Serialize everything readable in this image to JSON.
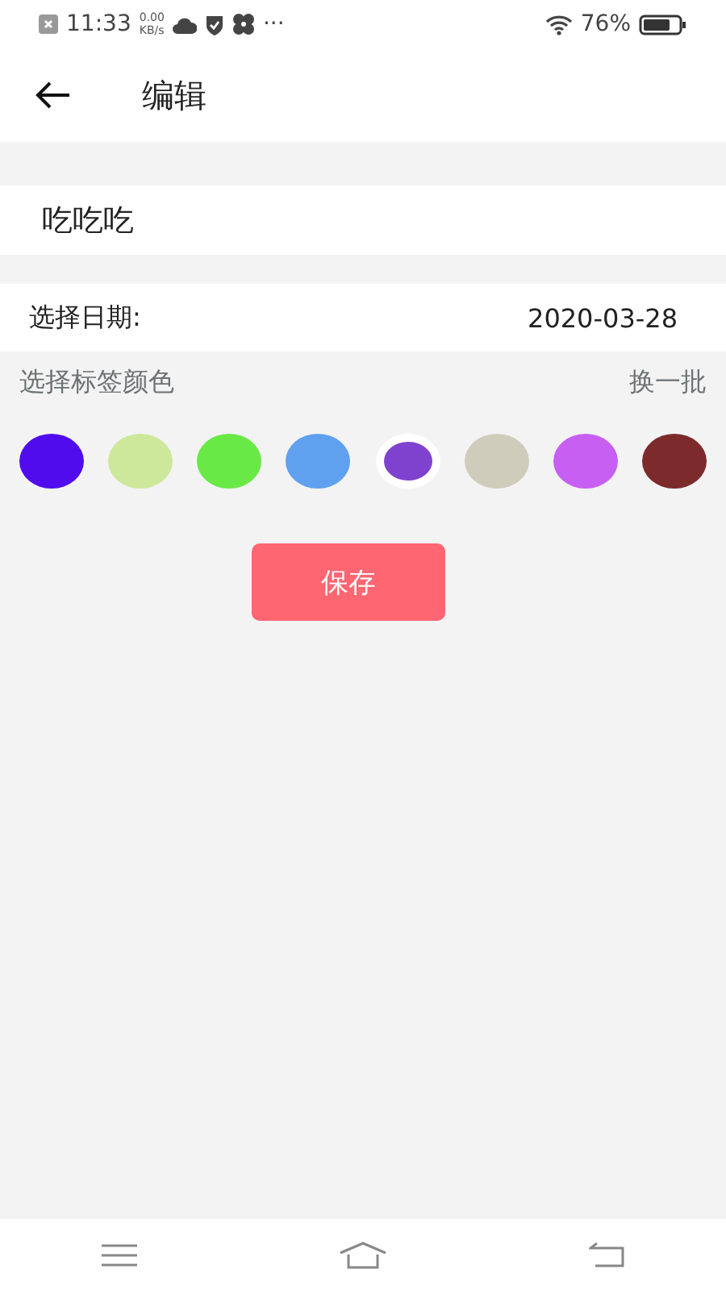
{
  "status_bar": {
    "time": "11:33",
    "speed_value": "0.00",
    "speed_unit": "KB/s",
    "more": "···",
    "battery": "76%"
  },
  "header": {
    "title": "编辑"
  },
  "name_field": {
    "value": "吃吃吃"
  },
  "date_row": {
    "label": "选择日期:",
    "value": "2020-03-28"
  },
  "color_section": {
    "label": "选择标签颜色",
    "refresh": "换一批",
    "colors": [
      {
        "color": "#500ced",
        "selected": false
      },
      {
        "color": "#cde89b",
        "selected": false
      },
      {
        "color": "#68e946",
        "selected": false
      },
      {
        "color": "#5fa0ef",
        "selected": false
      },
      {
        "color": "#7f42cf",
        "selected": true
      },
      {
        "color": "#d0ccbc",
        "selected": false
      },
      {
        "color": "#c75ff3",
        "selected": false
      },
      {
        "color": "#7c2a2b",
        "selected": false
      }
    ]
  },
  "save_button": {
    "label": "保存"
  }
}
